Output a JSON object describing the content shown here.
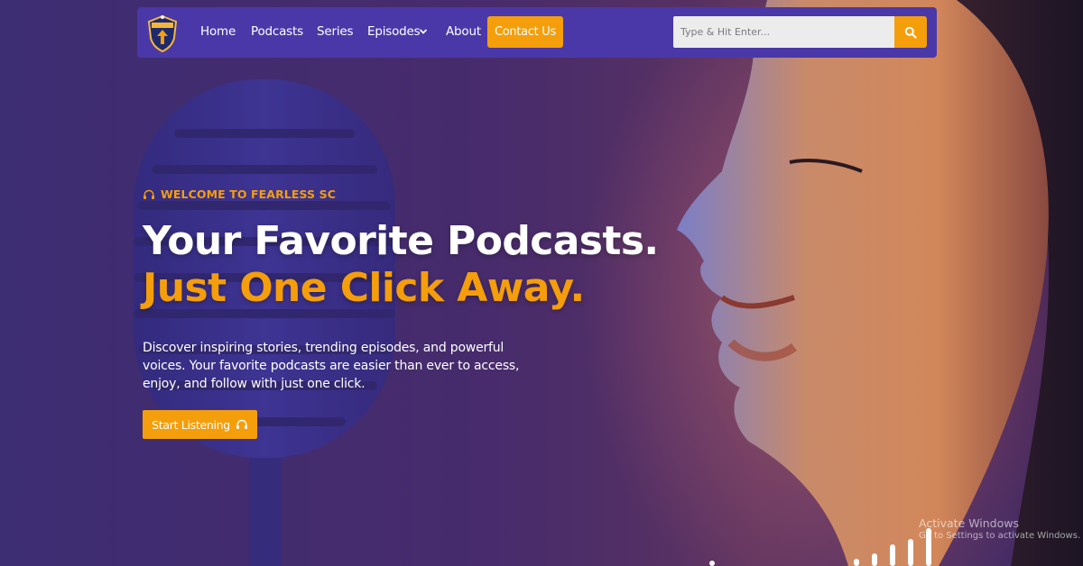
{
  "brand": {
    "logo_icon": "shield-crest-icon"
  },
  "nav": {
    "items": [
      {
        "label": "Home"
      },
      {
        "label": "Podcasts"
      },
      {
        "label": "Series"
      },
      {
        "label": "Episodes"
      },
      {
        "label": "About"
      }
    ],
    "contact_label": "Contact Us"
  },
  "search": {
    "placeholder": "Type & Hit Enter...",
    "icon": "search-icon"
  },
  "hero": {
    "eyebrow": "WELCOME TO FEARLESS SC",
    "headline_line1": "Your Favorite Podcasts.",
    "headline_line2": "Just One Click Away.",
    "description": "Discover inspiring stories, trending episodes, and powerful voices. Your favorite podcasts are easier than ever to access, enjoy, and follow with just one click.",
    "cta_label": "Start Listening"
  },
  "watermark": {
    "title": "Activate Windows",
    "subtitle": "Go to Settings to activate Windows."
  },
  "colors": {
    "accent": "#f59e0b",
    "navbar": "#4a38a8",
    "background": "#44296b"
  }
}
